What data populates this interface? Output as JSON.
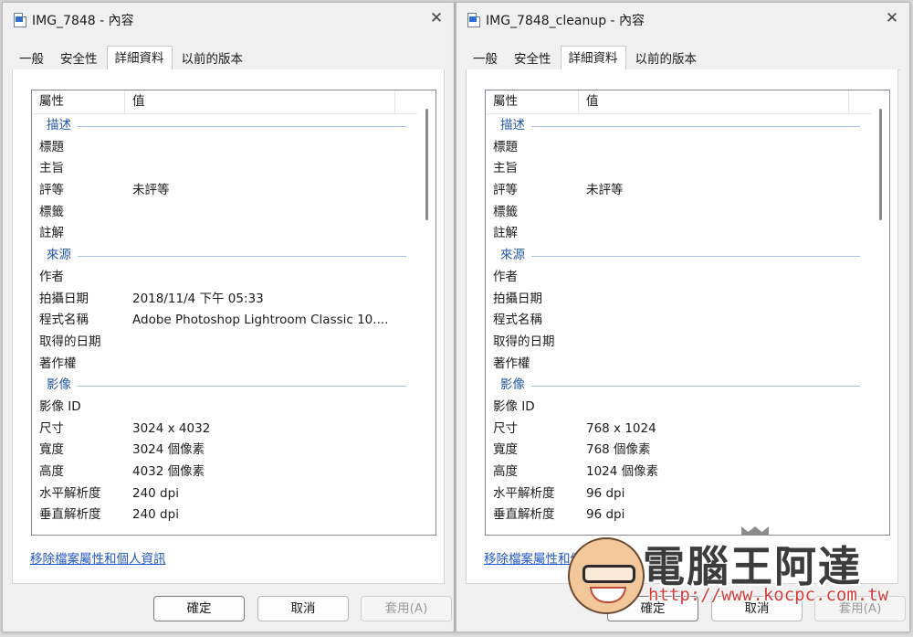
{
  "left": {
    "title": "IMG_7848 - 內容",
    "tabs": [
      "一般",
      "安全性",
      "詳細資料",
      "以前的版本"
    ],
    "active_tab": "詳細資料",
    "header": {
      "property": "屬性",
      "value": "值"
    },
    "rows": [
      {
        "kind": "group",
        "label": "描述"
      },
      {
        "kind": "item",
        "label": "標題",
        "value": ""
      },
      {
        "kind": "item",
        "label": "主旨",
        "value": ""
      },
      {
        "kind": "item",
        "label": "評等",
        "value": "未評等"
      },
      {
        "kind": "item",
        "label": "標籤",
        "value": ""
      },
      {
        "kind": "item",
        "label": "註解",
        "value": ""
      },
      {
        "kind": "group",
        "label": "來源"
      },
      {
        "kind": "item",
        "label": "作者",
        "value": ""
      },
      {
        "kind": "item",
        "label": "拍攝日期",
        "value": "2018/11/4 下午 05:33"
      },
      {
        "kind": "item",
        "label": "程式名稱",
        "value": "Adobe Photoshop Lightroom Classic 10...."
      },
      {
        "kind": "item",
        "label": "取得的日期",
        "value": ""
      },
      {
        "kind": "item",
        "label": "著作權",
        "value": ""
      },
      {
        "kind": "group",
        "label": "影像"
      },
      {
        "kind": "item",
        "label": "影像 ID",
        "value": ""
      },
      {
        "kind": "item",
        "label": "尺寸",
        "value": "3024 x 4032"
      },
      {
        "kind": "item",
        "label": "寬度",
        "value": "3024 個像素"
      },
      {
        "kind": "item",
        "label": "高度",
        "value": "4032 個像素"
      },
      {
        "kind": "item",
        "label": "水平解析度",
        "value": "240 dpi"
      },
      {
        "kind": "item",
        "label": "垂直解析度",
        "value": "240 dpi"
      }
    ],
    "remove_link": "移除檔案屬性和個人資訊",
    "buttons": {
      "ok": "確定",
      "cancel": "取消",
      "apply": "套用(A)"
    }
  },
  "right": {
    "title": "IMG_7848_cleanup - 內容",
    "tabs": [
      "一般",
      "安全性",
      "詳細資料",
      "以前的版本"
    ],
    "active_tab": "詳細資料",
    "header": {
      "property": "屬性",
      "value": "值"
    },
    "rows": [
      {
        "kind": "group",
        "label": "描述"
      },
      {
        "kind": "item",
        "label": "標題",
        "value": ""
      },
      {
        "kind": "item",
        "label": "主旨",
        "value": ""
      },
      {
        "kind": "item",
        "label": "評等",
        "value": "未評等"
      },
      {
        "kind": "item",
        "label": "標籤",
        "value": ""
      },
      {
        "kind": "item",
        "label": "註解",
        "value": ""
      },
      {
        "kind": "group",
        "label": "來源"
      },
      {
        "kind": "item",
        "label": "作者",
        "value": ""
      },
      {
        "kind": "item",
        "label": "拍攝日期",
        "value": ""
      },
      {
        "kind": "item",
        "label": "程式名稱",
        "value": ""
      },
      {
        "kind": "item",
        "label": "取得的日期",
        "value": ""
      },
      {
        "kind": "item",
        "label": "著作權",
        "value": ""
      },
      {
        "kind": "group",
        "label": "影像"
      },
      {
        "kind": "item",
        "label": "影像 ID",
        "value": ""
      },
      {
        "kind": "item",
        "label": "尺寸",
        "value": "768 x 1024"
      },
      {
        "kind": "item",
        "label": "寬度",
        "value": "768 個像素"
      },
      {
        "kind": "item",
        "label": "高度",
        "value": "1024 個像素"
      },
      {
        "kind": "item",
        "label": "水平解析度",
        "value": "96 dpi"
      },
      {
        "kind": "item",
        "label": "垂直解析度",
        "value": "96 dpi"
      }
    ],
    "remove_link": "移除檔案屬性和個人資訊",
    "buttons": {
      "ok": "確定",
      "cancel": "取消",
      "apply": "套用(A)"
    }
  },
  "watermark": {
    "title": "電腦王阿達",
    "url": "http://www.kocpc.com.tw"
  },
  "icons": {
    "file": "image-file-icon",
    "close": "close-icon"
  },
  "colors": {
    "link": "#2357c2",
    "group_heading": "#2357a8",
    "window_bg": "#f0f0f0"
  }
}
